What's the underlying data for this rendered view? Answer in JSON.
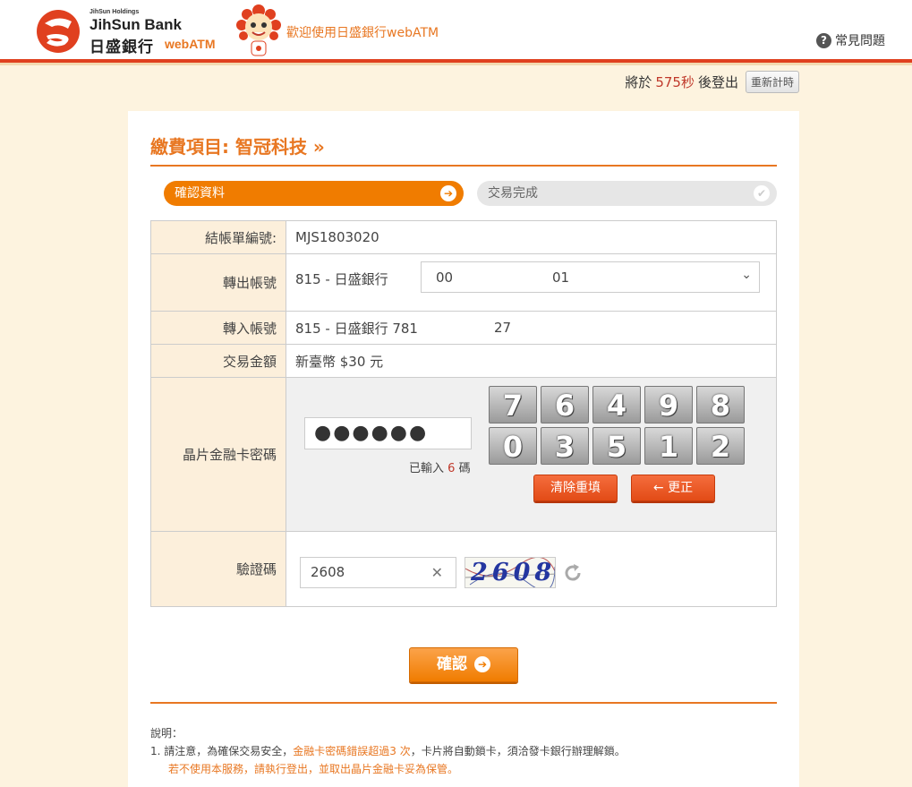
{
  "header": {
    "holdings": "JihSun Holdings",
    "bank_en": "JihSun Bank",
    "bank_zh": "日盛銀行",
    "webatm": "webATM",
    "welcome": "歡迎使用日盛銀行webATM",
    "faq": "常見問題"
  },
  "timer": {
    "prefix": "將於",
    "seconds": "575秒",
    "suffix": "後登出",
    "reset": "重新計時"
  },
  "page": {
    "title": "繳費項目: 智冠科技 »",
    "steps": [
      "確認資料",
      "交易完成"
    ]
  },
  "form": {
    "bill_label": "結帳單編號:",
    "bill_value": "MJS1803020",
    "from_label": "轉出帳號",
    "from_bank": "815 - 日盛銀行",
    "from_account_a": "00",
    "from_account_b": "01",
    "to_label": "轉入帳號",
    "to_value": "815 - 日盛銀行 781",
    "to_value_tail": "27",
    "amount_label": "交易金額",
    "amount_value": "新臺幣 $30 元",
    "pin_label": "晶片金融卡密碼",
    "pin_masked": "●●●●●●",
    "pin_count_prefix": "已輸入",
    "pin_count": "6",
    "pin_count_suffix": "碼",
    "keypad": [
      "7",
      "6",
      "4",
      "9",
      "8",
      "0",
      "3",
      "5",
      "1",
      "2"
    ],
    "clear_btn": "清除重填",
    "back_btn": "← 更正",
    "captcha_label": "驗證碼",
    "captcha_value": "2608",
    "captcha_image_text": "2608"
  },
  "confirm": "確認",
  "notes": {
    "heading": "說明：",
    "line1_a": "1.  請注意，為確保交易安全，",
    "line1_hl": "金融卡密碼錯誤超過3 次",
    "line1_b": "，卡片將自動鎖卡，須洽發卡銀行辦理解鎖。",
    "line2": "若不使用本服務，請執行登出，並取出晶片金融卡妥為保管。"
  },
  "colors": {
    "accent": "#f07c00",
    "header_bar": "#e0401f",
    "background": "#fdf3df"
  }
}
